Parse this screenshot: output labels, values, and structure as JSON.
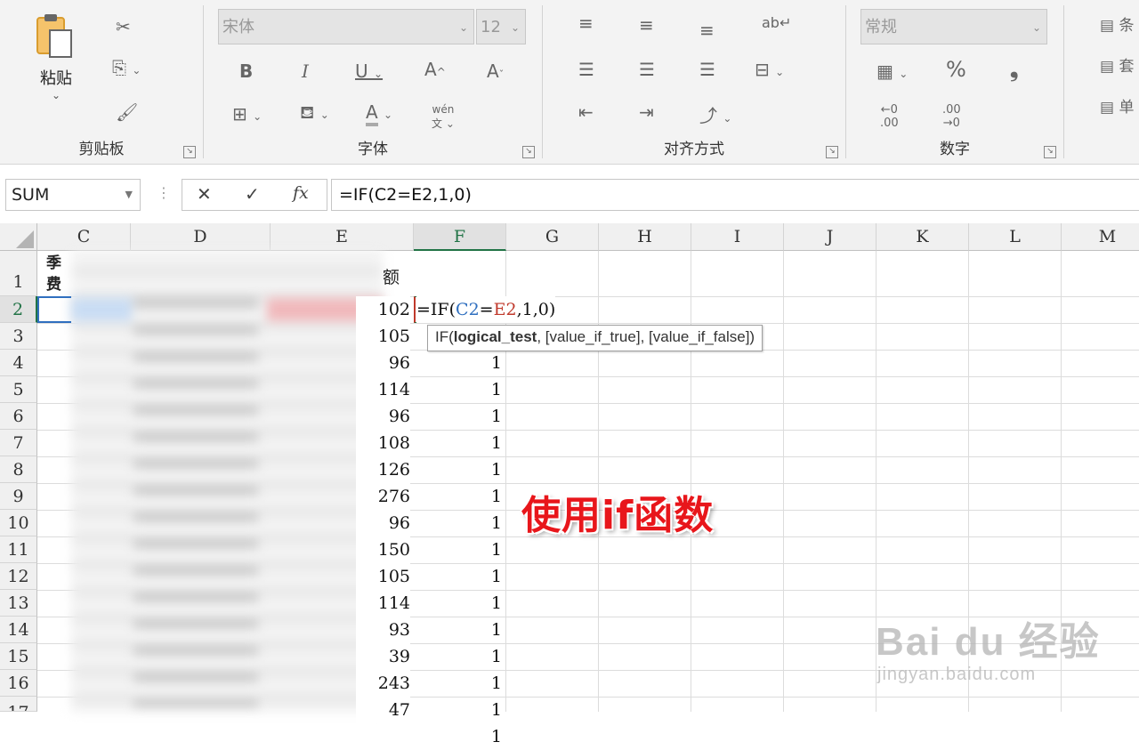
{
  "ribbon": {
    "clipboard": {
      "paste_label": "粘贴",
      "group_label": "剪贴板"
    },
    "font": {
      "font_name": "宋体",
      "font_size": "12",
      "group_label": "字体"
    },
    "alignment": {
      "group_label": "对齐方式"
    },
    "number": {
      "format": "常规",
      "group_label": "数字",
      "percent": "%",
      "comma": "❟"
    },
    "styles": {
      "items": [
        "条",
        "套",
        "单"
      ]
    }
  },
  "formula_bar": {
    "name_box": "SUM",
    "cancel": "✕",
    "enter": "✓",
    "fx": "fx",
    "formula": "=IF(C2=E2,1,0)"
  },
  "grid": {
    "columns": [
      "C",
      "D",
      "E",
      "F",
      "G",
      "H",
      "I",
      "J",
      "K",
      "L",
      "M"
    ],
    "rows": [
      "1",
      "2",
      "3",
      "4",
      "5",
      "6",
      "7",
      "8",
      "9",
      "10",
      "11",
      "12",
      "13",
      "14",
      "15",
      "16",
      "17"
    ],
    "header_c1_line1": "季",
    "header_c1_line2": "费",
    "header_e1": "额",
    "e_values": [
      "102",
      "105",
      "96",
      "114",
      "96",
      "108",
      "126",
      "276",
      "96",
      "150",
      "105",
      "114",
      "93",
      "39",
      "243",
      "47"
    ],
    "f_values": [
      "1",
      "1",
      "1",
      "1",
      "1",
      "1",
      "1",
      "1",
      "1",
      "1",
      "1",
      "1",
      "1",
      "1",
      "1"
    ],
    "edit_formula_prefix": "=IF(",
    "edit_ref1": "C2",
    "edit_eq": "=",
    "edit_ref2": "E2",
    "edit_formula_suffix": ",1,0)",
    "tooltip_fn": "IF(",
    "tooltip_bold": "logical_test",
    "tooltip_rest": ", [value_if_true], [value_if_false])"
  },
  "overlay": {
    "caption": "使用if函数",
    "watermark_brand": "Bai du 经验",
    "watermark_url": "jingyan.baidu.com"
  },
  "colors": {
    "excel_green": "#217346",
    "caption_red": "#e8161b",
    "ref_blue": "#2f6fbf",
    "ref_red": "#c0392b"
  }
}
